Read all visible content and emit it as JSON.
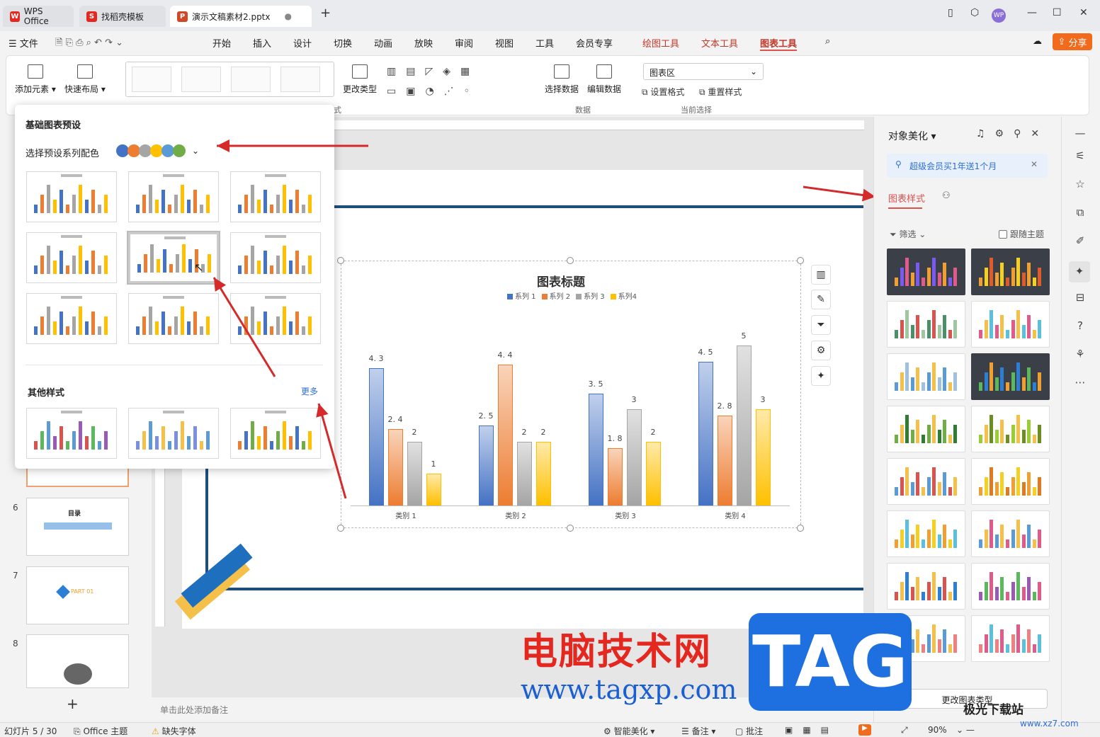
{
  "tabs": [
    {
      "label": "WPS Office"
    },
    {
      "label": "找稻壳模板"
    },
    {
      "label": "演示文稿素材2.pptx"
    }
  ],
  "user_initials": "WP",
  "menu": {
    "file": "文件",
    "items": [
      "开始",
      "插入",
      "设计",
      "切换",
      "动画",
      "放映",
      "审阅",
      "视图",
      "工具",
      "会员专享"
    ],
    "context_items": [
      "绘图工具",
      "文本工具",
      "图表工具"
    ],
    "share": "分享"
  },
  "ribbon": {
    "add_element": "添加元素",
    "quick_layout": "快速布局",
    "style_group_fragment": "式",
    "change_type": "更改类型",
    "select_data": "选择数据",
    "edit_data": "编辑数据",
    "data_group": "数据",
    "chart_area": "图表区",
    "set_format": "设置格式",
    "reset_style": "重置样式",
    "current_selection": "当前选择"
  },
  "popup": {
    "title": "基础图表预设",
    "palette_label": "选择预设系列配色",
    "palette_colors": [
      "#4472c4",
      "#ed7d31",
      "#a5a5a5",
      "#ffc000",
      "#5b9bd5",
      "#70ad47"
    ],
    "other_styles": "其他样式",
    "more": "更多"
  },
  "slides": [
    {
      "num": "6",
      "label": "目录"
    },
    {
      "num": "7",
      "label": "PART 01"
    },
    {
      "num": "8",
      "label": ""
    }
  ],
  "chart_data": {
    "type": "bar",
    "title": "图表标题",
    "categories": [
      "类别 1",
      "类别 2",
      "类别 3",
      "类别 4"
    ],
    "series": [
      {
        "name": "系列 1",
        "values": [
          4.3,
          2.5,
          3.5,
          4.5
        ],
        "color": "#4472c4"
      },
      {
        "name": "系列 2",
        "values": [
          2.4,
          4.4,
          1.8,
          2.8
        ],
        "color": "#ed7d31"
      },
      {
        "name": "系列 3",
        "values": [
          2,
          2,
          3,
          5
        ],
        "color": "#a5a5a5"
      },
      {
        "name": "系列4",
        "values": [
          1,
          2,
          2,
          3
        ],
        "color": "#ffc000"
      }
    ],
    "value_labels": [
      [
        "4. 3",
        "2. 5",
        "3. 5",
        "4. 5"
      ],
      [
        "2. 4",
        "4. 4",
        "1. 8",
        "2. 8"
      ],
      [
        "2",
        "2",
        "3",
        "5"
      ],
      [
        "1",
        "2",
        "2",
        "3"
      ]
    ],
    "ylim": [
      0,
      5
    ],
    "grid": false,
    "legend": "top"
  },
  "right_pane": {
    "title": "对象美化",
    "promo": "超级会员买1年送1个月",
    "tab_chart_style": "图表样式",
    "filter": "筛选",
    "follow_theme": "跟随主题",
    "change_chart_type": "更改图表类型"
  },
  "notes_placeholder": "单击此处添加备注",
  "status": {
    "slide_index": "幻灯片 5 / 30",
    "theme": "Office 主题",
    "missing_font": "缺失字体",
    "smart_beautify": "智能美化",
    "notes": "备注",
    "comments": "批注",
    "zoom": "90%"
  },
  "watermark": {
    "text": "电脑技术网",
    "url": "www.tagxp.com",
    "tag": "TAG",
    "site": "极光下载站",
    "site_url": "www.xz7.com"
  }
}
